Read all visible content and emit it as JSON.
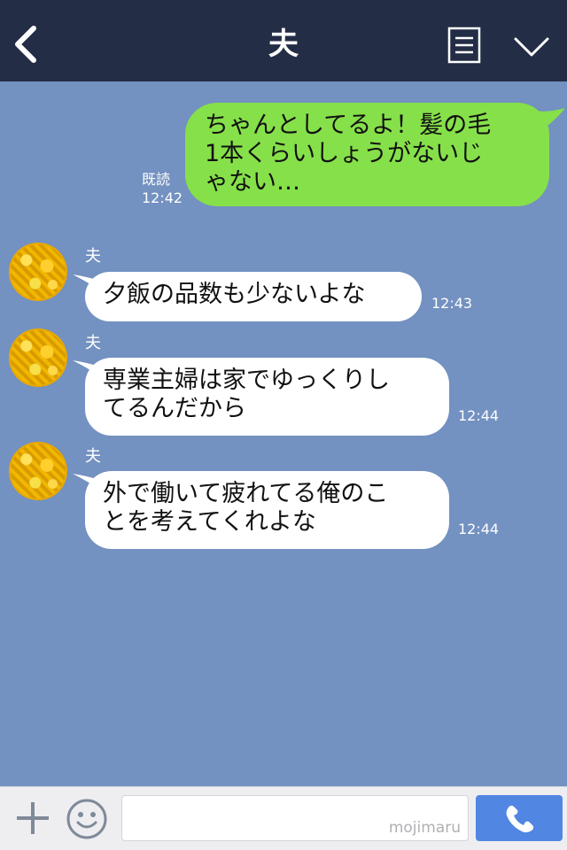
{
  "header": {
    "title": "夫"
  },
  "messages": [
    {
      "side": "right",
      "lines": [
        "ちゃんとしてるよ！髪の毛",
        "1本くらいしょうがないじ",
        "ゃない…"
      ],
      "read_label": "既読",
      "time": "12:42"
    },
    {
      "side": "left",
      "sender": "夫",
      "lines": [
        "夕飯の品数も少ないよな"
      ],
      "time": "12:43"
    },
    {
      "side": "left",
      "sender": "夫",
      "lines": [
        "専業主婦は家でゆっくりし",
        "てるんだから"
      ],
      "time": "12:44"
    },
    {
      "side": "left",
      "sender": "夫",
      "lines": [
        "外で働いて疲れてる俺のこ",
        "とを考えてくれよな"
      ],
      "time": "12:44"
    }
  ],
  "input": {
    "value": "",
    "watermark": "mojimaru"
  },
  "icons": {
    "back": "chevron-left-icon",
    "notes": "notes-icon",
    "menu": "chevron-down-icon",
    "plus": "plus-icon",
    "emoji": "smiley-icon",
    "call": "phone-icon"
  },
  "colors": {
    "header_bg": "#232d45",
    "chat_bg": "#7391c1",
    "own_bubble": "#86e04a",
    "other_bubble": "#ffffff",
    "call_button": "#5186e3"
  }
}
